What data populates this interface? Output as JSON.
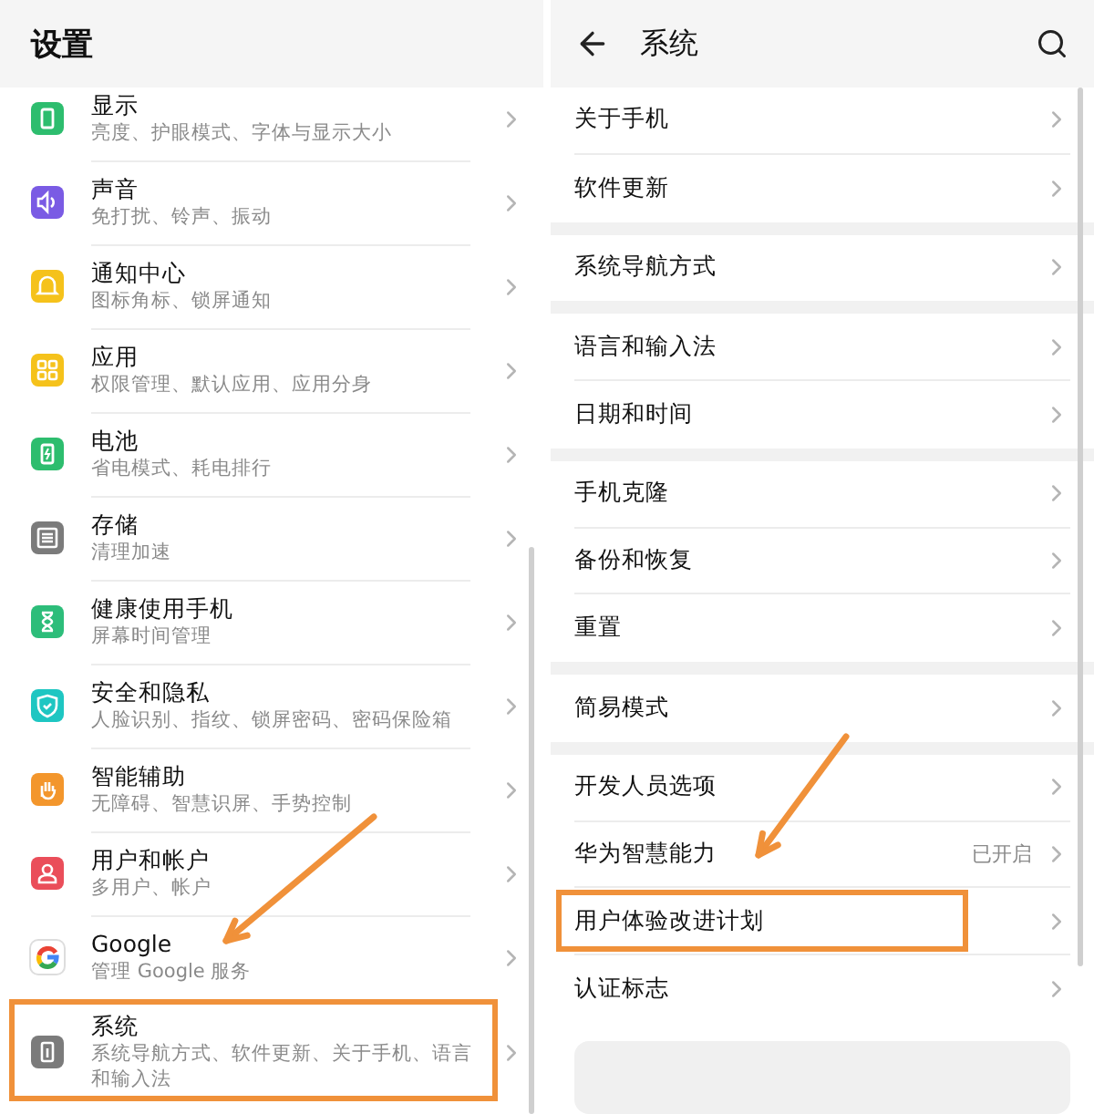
{
  "left_screen": {
    "title": "设置",
    "items": [
      {
        "title": "显示",
        "subtitle": "亮度、护眼模式、字体与显示大小",
        "color": "#2dbd6e",
        "highlighted": false
      },
      {
        "title": "声音",
        "subtitle": "免打扰、铃声、振动",
        "color": "#7a5be4",
        "highlighted": false
      },
      {
        "title": "通知中心",
        "subtitle": "图标角标、锁屏通知",
        "color": "#f5c21b",
        "highlighted": false
      },
      {
        "title": "应用",
        "subtitle": "权限管理、默认应用、应用分身",
        "color": "#f5c21b",
        "highlighted": false
      },
      {
        "title": "电池",
        "subtitle": "省电模式、耗电排行",
        "color": "#2dbd6e",
        "highlighted": false
      },
      {
        "title": "存储",
        "subtitle": "清理加速",
        "color": "#7b7b7b",
        "highlighted": false
      },
      {
        "title": "健康使用手机",
        "subtitle": "屏幕时间管理",
        "color": "#2dbd7a",
        "highlighted": false
      },
      {
        "title": "安全和隐私",
        "subtitle": "人脸识别、指纹、锁屏密码、密码保险箱",
        "color": "#1ec6c2",
        "highlighted": false
      },
      {
        "title": "智能辅助",
        "subtitle": "无障碍、智慧识屏、手势控制",
        "color": "#f3962c",
        "highlighted": false
      },
      {
        "title": "用户和帐户",
        "subtitle": "多用户、帐户",
        "color": "#ea4e5a",
        "highlighted": false
      },
      {
        "title": "Google",
        "subtitle": "管理 Google 服务",
        "color": "#ffffff",
        "highlighted": false
      },
      {
        "title": "系统",
        "subtitle": "系统导航方式、软件更新、关于手机、语言和输入法",
        "color": "#7b7b7b",
        "highlighted": true
      }
    ]
  },
  "right_screen": {
    "title": "系统",
    "groups": [
      [
        {
          "label": "关于手机",
          "highlighted": false
        },
        {
          "label": "软件更新",
          "highlighted": false
        }
      ],
      [
        {
          "label": "系统导航方式",
          "highlighted": false
        }
      ],
      [
        {
          "label": "语言和输入法",
          "highlighted": false
        },
        {
          "label": "日期和时间",
          "highlighted": false
        }
      ],
      [
        {
          "label": "手机克隆",
          "highlighted": false
        },
        {
          "label": "备份和恢复",
          "highlighted": false
        },
        {
          "label": "重置",
          "highlighted": false
        }
      ],
      [
        {
          "label": "简易模式",
          "highlighted": false
        }
      ],
      [
        {
          "label": "开发人员选项",
          "highlighted": false
        },
        {
          "label": "华为智慧能力",
          "value": "已开启",
          "highlighted": false
        },
        {
          "label": "用户体验改进计划",
          "highlighted": true
        },
        {
          "label": "认证标志",
          "highlighted": false
        }
      ]
    ]
  }
}
